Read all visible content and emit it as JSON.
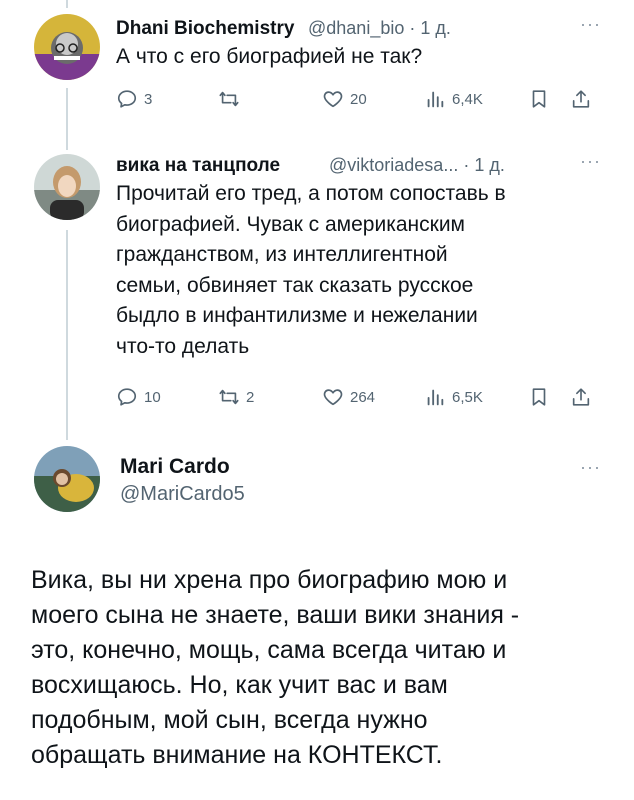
{
  "tweets": [
    {
      "name": "Dhani Biochemistry",
      "handle": "@dhani_bio",
      "time": "1 д.",
      "text": "А что с его биографией не так?",
      "replies": "3",
      "retweets": "",
      "likes": "20",
      "views": "6,4K"
    },
    {
      "name": "вика на танцполе",
      "handle": "@viktoriadesa...",
      "time": "1 д.",
      "text_lines": [
        "Прочитай его тред, а потом сопоставь в",
        "биографией. Чувак с американским",
        "гражданством, из интеллигентной",
        "семьи, обвиняет так сказать русское",
        "быдло в инфантилизме и нежелании",
        "что-то делать"
      ],
      "replies": "10",
      "retweets": "2",
      "likes": "264",
      "views": "6,5K"
    }
  ],
  "main_tweet": {
    "name": "Mari Cardo",
    "handle": "@MariCardo5",
    "text_lines": [
      "Вика, вы ни хрена про биографию мою и",
      "моего сына не знаете, ваши вики знания -",
      "это, конечно, мощь, сама всегда читаю и",
      "восхищаюсь. Но, как учит вас и вам",
      "подобным, мой сын, всегда нужно",
      "обращать внимание на КОНТЕКСТ."
    ]
  },
  "separator": "·",
  "more_glyph": "···",
  "icons": [
    "reply-icon",
    "retweet-icon",
    "like-icon",
    "views-icon",
    "bookmark-icon",
    "share-icon",
    "more-icon"
  ],
  "colors": {
    "text": "#0f1419",
    "secondary": "#536471",
    "thread_line": "#cfd9de",
    "background": "#ffffff"
  }
}
